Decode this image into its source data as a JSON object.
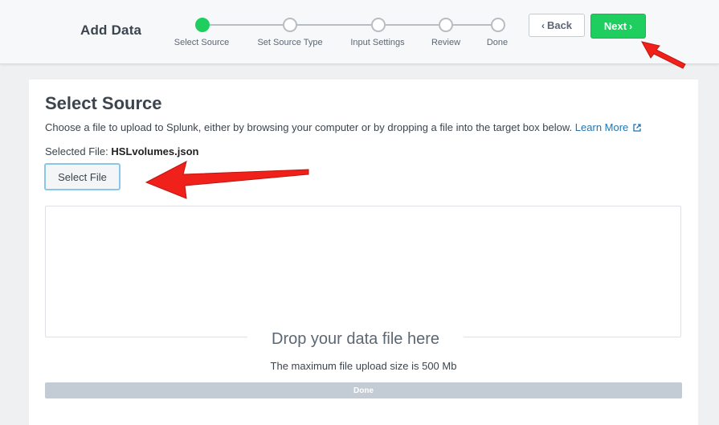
{
  "header": {
    "title": "Add Data",
    "steps": [
      {
        "label": "Select Source",
        "active": true
      },
      {
        "label": "Set Source Type",
        "active": false
      },
      {
        "label": "Input Settings",
        "active": false
      },
      {
        "label": "Review",
        "active": false
      },
      {
        "label": "Done",
        "active": false
      }
    ],
    "back_label": "Back",
    "next_label": "Next"
  },
  "main": {
    "title": "Select Source",
    "description": "Choose a file to upload to Splunk, either by browsing your computer or by dropping a file into the target box below.",
    "learn_more": "Learn More",
    "selected_file_label": "Selected File:",
    "selected_file_name": "HSLvolumes.json",
    "select_file_button": "Select File",
    "drop_text": "Drop your data file here",
    "max_size_text": "The maximum file upload size is 500 Mb",
    "progress_label": "Done"
  },
  "colors": {
    "accent_green": "#1ecf5f",
    "link_blue": "#1e75b3",
    "annotation_red": "#f0201a"
  }
}
